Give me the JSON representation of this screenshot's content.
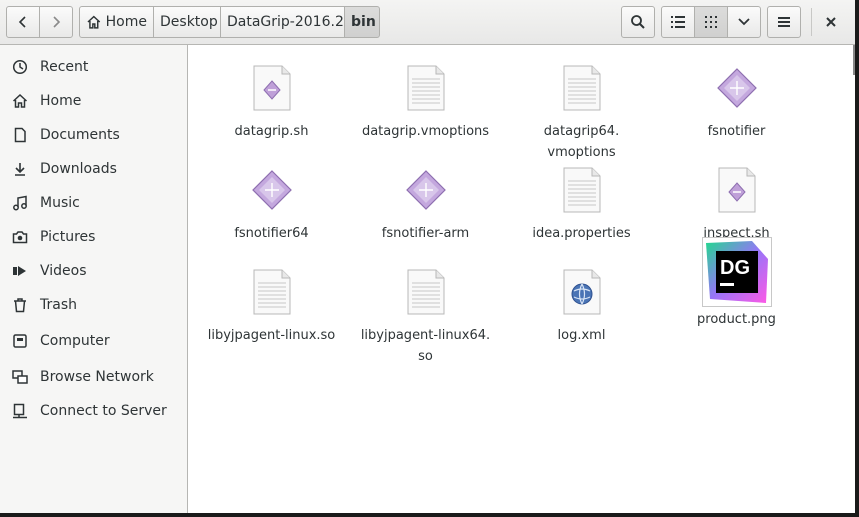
{
  "header": {
    "breadcrumbs": [
      {
        "label": "Home",
        "icon": "home-icon"
      },
      {
        "label": "Desktop"
      },
      {
        "label": "DataGrip-2016.2"
      },
      {
        "label": "bin"
      }
    ]
  },
  "sidebar": {
    "items": [
      {
        "label": "Recent",
        "icon": "clock-icon"
      },
      {
        "label": "Home",
        "icon": "home-icon"
      },
      {
        "label": "Documents",
        "icon": "document-icon"
      },
      {
        "label": "Downloads",
        "icon": "download-icon"
      },
      {
        "label": "Music",
        "icon": "music-icon"
      },
      {
        "label": "Pictures",
        "icon": "camera-icon"
      },
      {
        "label": "Videos",
        "icon": "video-icon"
      },
      {
        "label": "Trash",
        "icon": "trash-icon"
      },
      {
        "label": "Computer",
        "icon": "computer-icon"
      },
      {
        "label": "Browse Network",
        "icon": "network-icon"
      },
      {
        "label": "Connect to Server",
        "icon": "server-icon"
      }
    ]
  },
  "files": [
    {
      "name": "datagrip.sh",
      "type": "script"
    },
    {
      "name": "datagrip.vmoptions",
      "type": "text"
    },
    {
      "name": "datagrip64.\nvmoptions",
      "type": "text"
    },
    {
      "name": "fsnotifier",
      "type": "executable"
    },
    {
      "name": "fsnotifier64",
      "type": "executable"
    },
    {
      "name": "fsnotifier-arm",
      "type": "executable"
    },
    {
      "name": "idea.properties",
      "type": "text"
    },
    {
      "name": "inspect.sh",
      "type": "script"
    },
    {
      "name": "libyjpagent-linux.so",
      "type": "text"
    },
    {
      "name": "libyjpagent-linux64.\nso",
      "type": "text"
    },
    {
      "name": "log.xml",
      "type": "xml"
    },
    {
      "name": "product.png",
      "type": "image",
      "image_text": "DG"
    }
  ]
}
